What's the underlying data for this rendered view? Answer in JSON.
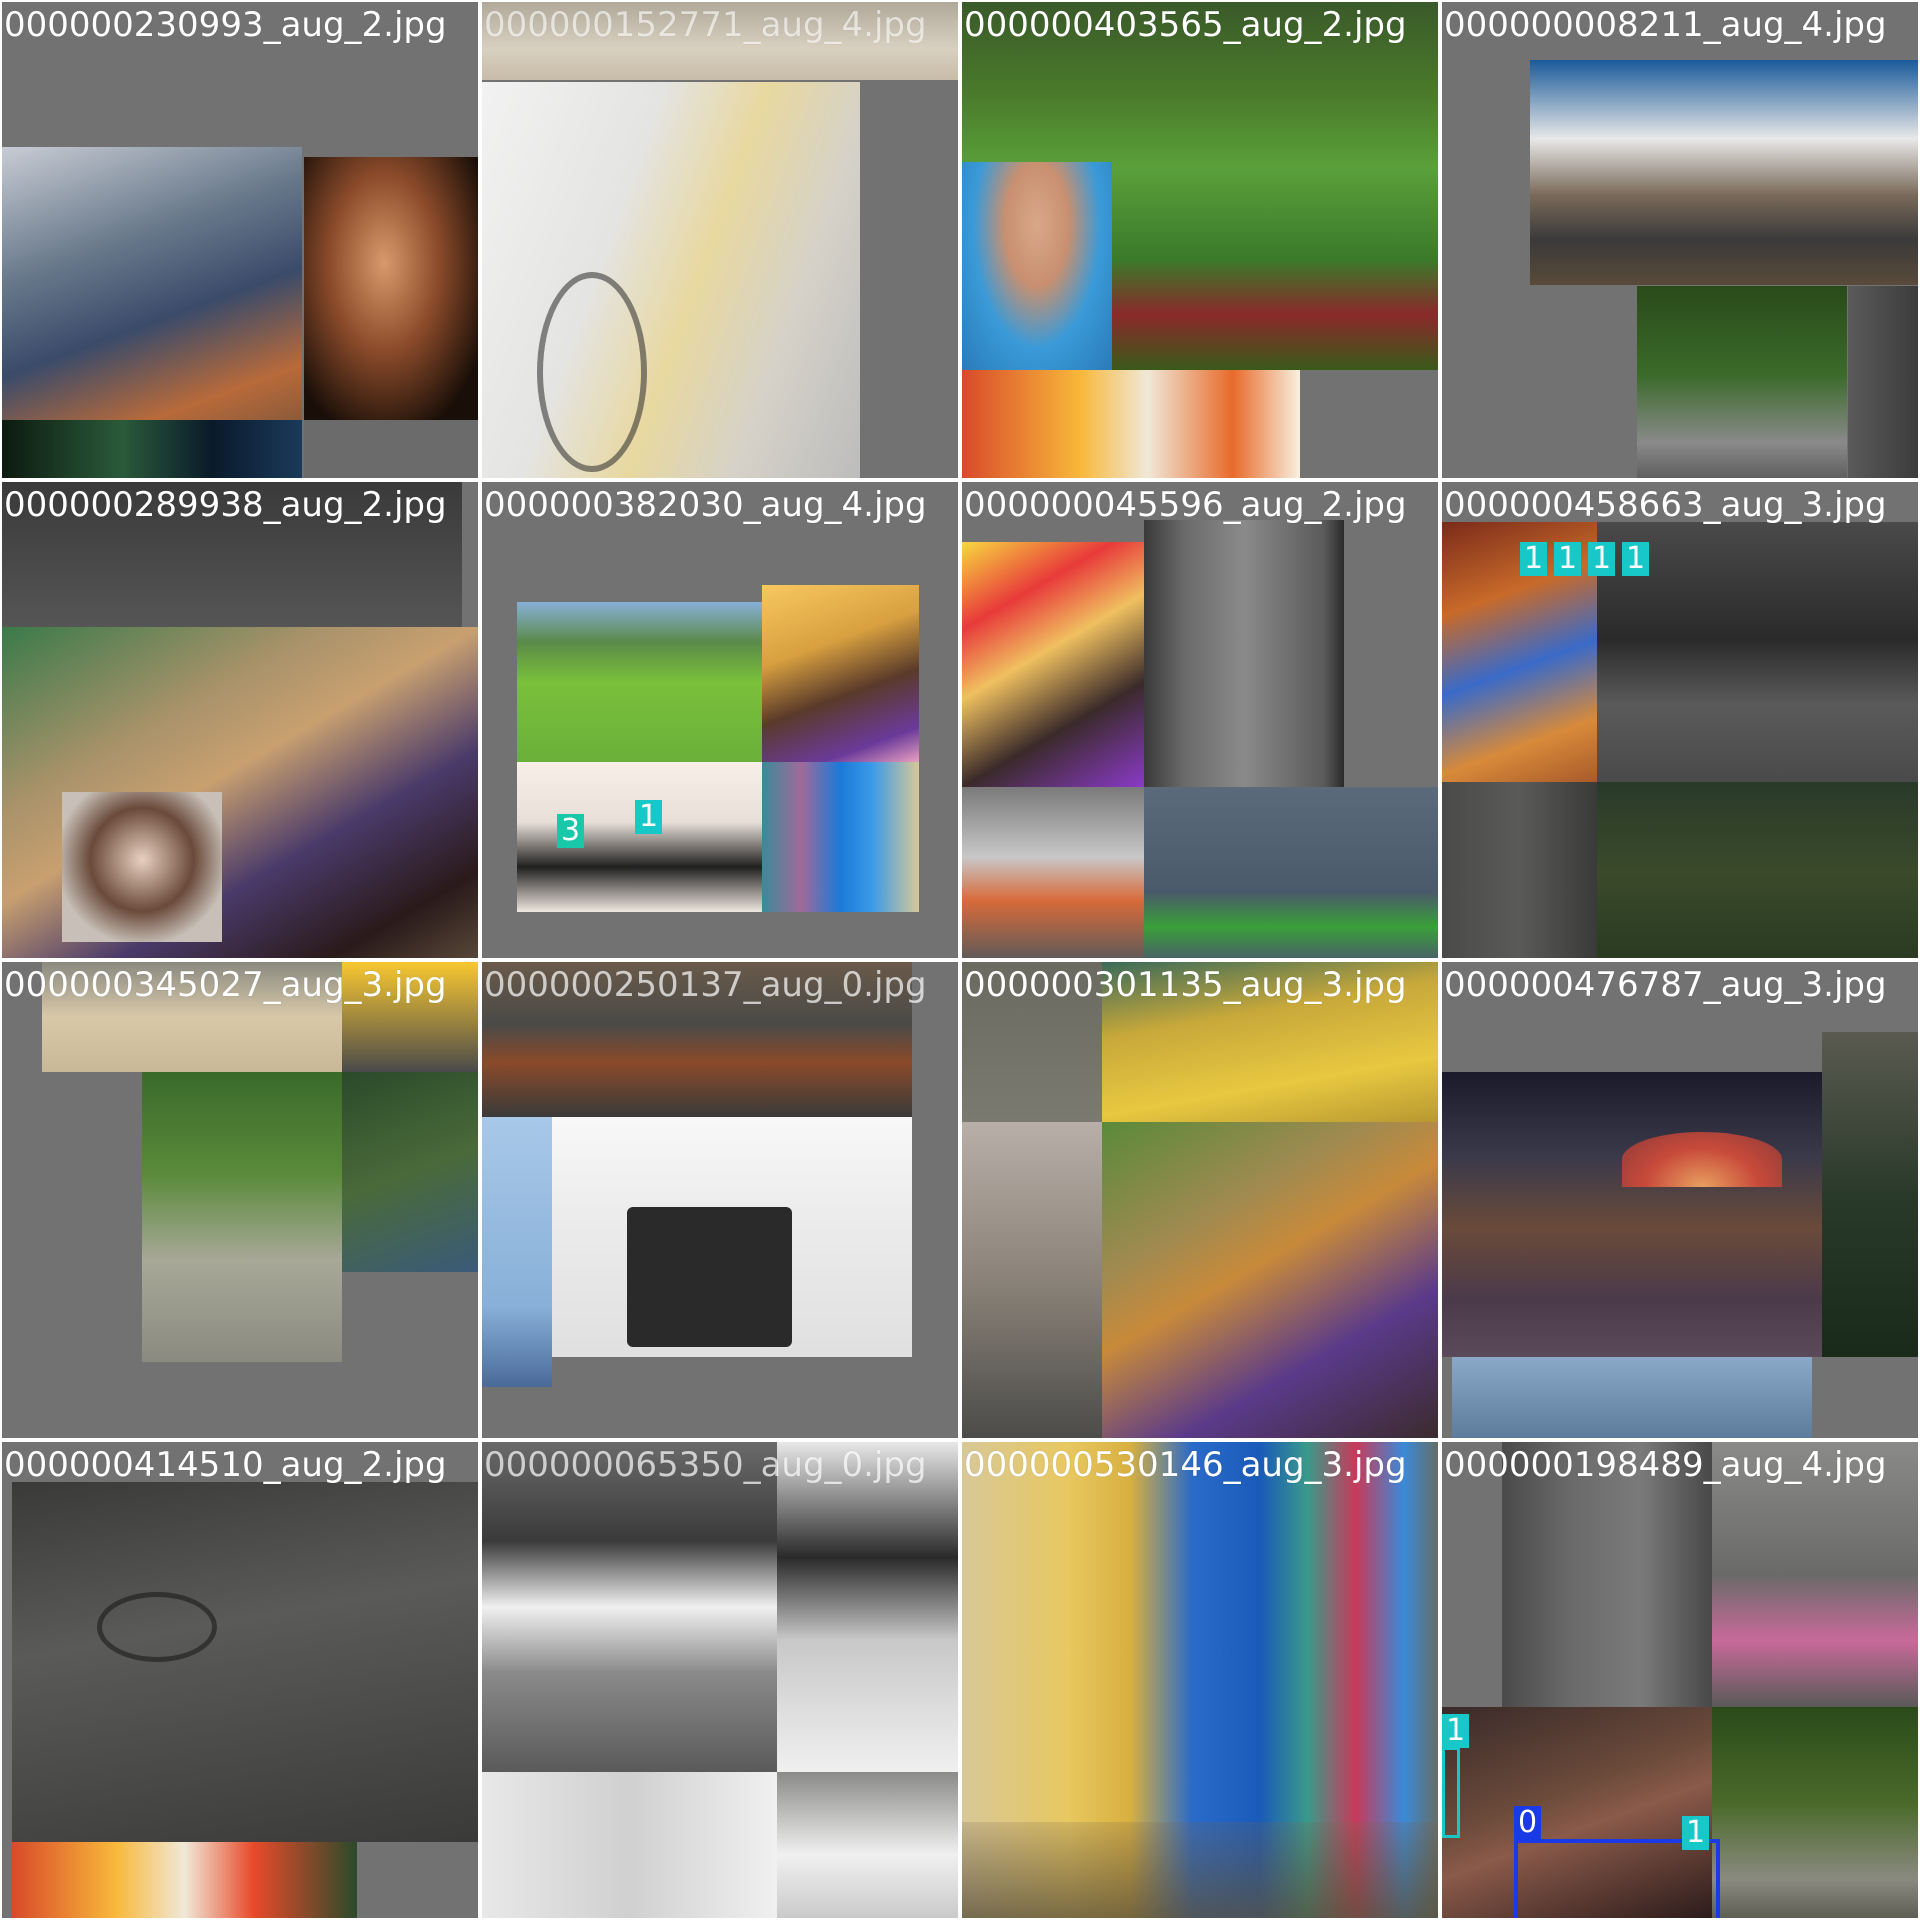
{
  "colors": {
    "background": "#727272",
    "label_text": "#ffffff",
    "border": "#ffffff"
  },
  "tiles": [
    {
      "label": "000000230993_aug_2.jpg",
      "tags": []
    },
    {
      "label": "000000152771_aug_4.jpg",
      "tags": []
    },
    {
      "label": "000000403565_aug_2.jpg",
      "tags": []
    },
    {
      "label": "000000008211_aug_4.jpg",
      "tags": []
    },
    {
      "label": "000000289938_aug_2.jpg",
      "tags": []
    },
    {
      "label": "000000382030_aug_4.jpg",
      "tags": [
        "3",
        "1"
      ]
    },
    {
      "label": "000000045596_aug_2.jpg",
      "tags": []
    },
    {
      "label": "000000458663_aug_3.jpg",
      "tags": [
        "1",
        "1",
        "1",
        "1"
      ]
    },
    {
      "label": "000000345027_aug_3.jpg",
      "tags": []
    },
    {
      "label": "000000250137_aug_0.jpg",
      "tags": []
    },
    {
      "label": "000000301135_aug_3.jpg",
      "tags": []
    },
    {
      "label": "000000476787_aug_3.jpg",
      "tags": []
    },
    {
      "label": "000000414510_aug_2.jpg",
      "tags": []
    },
    {
      "label": "000000065350_aug_0.jpg",
      "tags": []
    },
    {
      "label": "000000530146_aug_3.jpg",
      "tags": []
    },
    {
      "label": "000000198489_aug_4.jpg",
      "tags": [
        "1",
        "0",
        "1"
      ]
    }
  ]
}
